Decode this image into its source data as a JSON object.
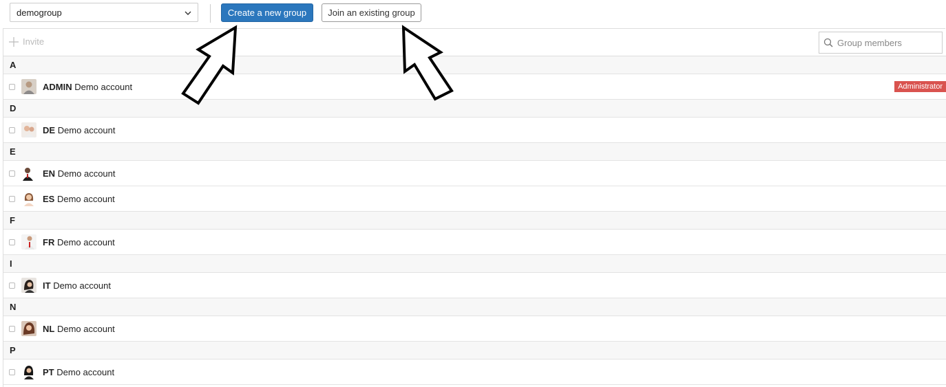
{
  "header": {
    "group_select_value": "demogroup",
    "create_button_label": "Create a new group",
    "join_button_label": "Join an existing group"
  },
  "toolbar": {
    "invite_label": "Invite",
    "search_placeholder": "Group members"
  },
  "sections": [
    {
      "letter": "A",
      "members": [
        {
          "code": "ADMIN",
          "name": "Demo account",
          "badge": "Administrator",
          "avatar": "avatar-admin"
        }
      ]
    },
    {
      "letter": "D",
      "members": [
        {
          "code": "DE",
          "name": "Demo account",
          "avatar": "avatar-de"
        }
      ]
    },
    {
      "letter": "E",
      "members": [
        {
          "code": "EN",
          "name": "Demo account",
          "avatar": "avatar-en"
        },
        {
          "code": "ES",
          "name": "Demo account",
          "avatar": "avatar-es"
        }
      ]
    },
    {
      "letter": "F",
      "members": [
        {
          "code": "FR",
          "name": "Demo account",
          "avatar": "avatar-fr"
        }
      ]
    },
    {
      "letter": "I",
      "members": [
        {
          "code": "IT",
          "name": "Demo account",
          "avatar": "avatar-it"
        }
      ]
    },
    {
      "letter": "N",
      "members": [
        {
          "code": "NL",
          "name": "Demo account",
          "avatar": "avatar-nl"
        }
      ]
    },
    {
      "letter": "P",
      "members": [
        {
          "code": "PT",
          "name": "Demo account",
          "avatar": "avatar-pt"
        }
      ]
    }
  ],
  "colors": {
    "primary": "#2b77bd",
    "badge": "#d9534f"
  }
}
